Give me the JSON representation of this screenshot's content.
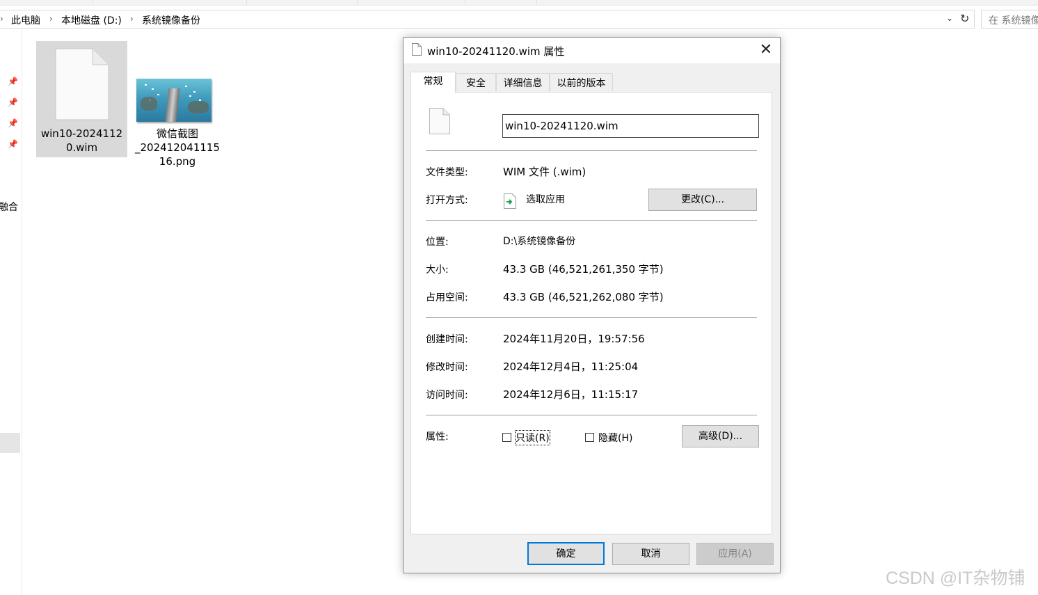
{
  "explorer": {
    "breadcrumb": [
      "此电脑",
      "本地磁盘 (D:)",
      "系统镜像备份"
    ],
    "search_placeholder": "在 系统镜像",
    "nav_partial_label": "星融合",
    "files": [
      {
        "name_line1": "win10-2024112",
        "name_line2": "0.wim",
        "icon": "blank-document-icon",
        "selected": true
      },
      {
        "name_line1": "微信截图",
        "name_line2": "_202412041115",
        "name_line3": "16.png",
        "icon": "image-thumbnail",
        "selected": false
      }
    ]
  },
  "dialog": {
    "title": "win10-20241120.wim 属性",
    "tabs": [
      "常规",
      "安全",
      "详细信息",
      "以前的版本"
    ],
    "active_tab": "常规",
    "filename": "win10-20241120.wim",
    "labels": {
      "file_type": "文件类型:",
      "open_with": "打开方式:",
      "location": "位置:",
      "size": "大小:",
      "size_on_disk": "占用空间:",
      "created": "创建时间:",
      "modified": "修改时间:",
      "accessed": "访问时间:",
      "attributes": "属性:"
    },
    "values": {
      "file_type": "WIM 文件 (.wim)",
      "open_with": "选取应用",
      "location": "D:\\系统镜像备份",
      "size": "43.3 GB (46,521,261,350 字节)",
      "size_on_disk": "43.3 GB (46,521,262,080 字节)",
      "created": "2024年11月20日，19:57:56",
      "modified": "2024年12月4日，11:25:04",
      "accessed": "2024年12月6日，11:15:17"
    },
    "buttons": {
      "change": "更改(C)...",
      "advanced": "高级(D)...",
      "ok": "确定",
      "cancel": "取消",
      "apply": "应用(A)"
    },
    "checkboxes": {
      "readonly": {
        "label": "只读(R)",
        "checked": false
      },
      "hidden": {
        "label": "隐藏(H)",
        "checked": false
      }
    }
  },
  "watermark": "CSDN @IT杂物铺",
  "colors": {
    "accent": "#0078d7",
    "selection": "#d9d9d9",
    "dialog_bg": "#f0f0f0"
  }
}
